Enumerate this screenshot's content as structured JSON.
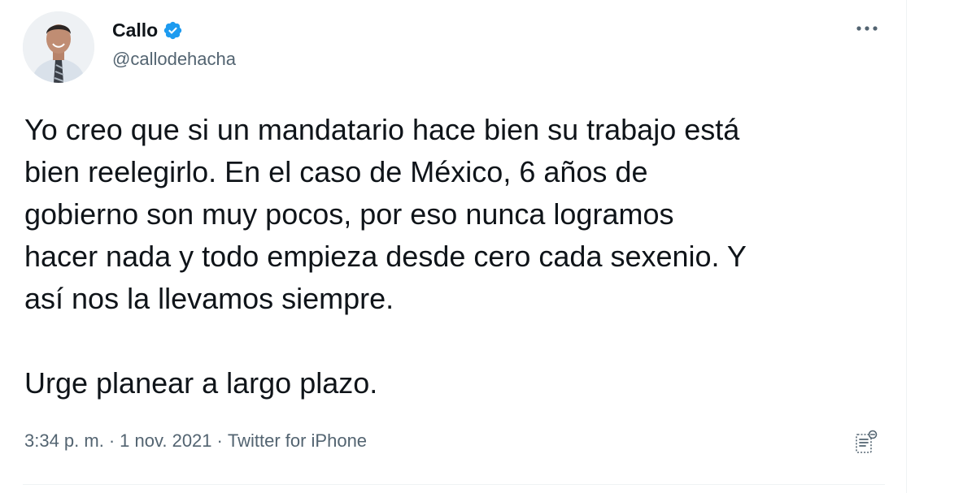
{
  "author": {
    "display_name": "Callo",
    "handle": "@callodehacha",
    "verified": true
  },
  "tweet": {
    "paragraphs": [
      "Yo creo que si un mandatario hace bien su trabajo está bien reelegirlo. En el caso de México, 6 años de gobierno son muy pocos, por eso nunca logramos hacer nada y todo empieza desde cero cada sexenio. Y así nos la llevamos siempre.",
      "Urge planear a largo plazo."
    ],
    "lines_p1": [
      "Yo creo que si un mandatario hace bien su trabajo está",
      "bien reelegirlo. En el caso de México, 6 años de",
      "gobierno son muy pocos, por eso nunca logramos",
      "hacer nada y todo empieza desde cero cada sexenio. Y",
      "así nos la llevamos siempre."
    ],
    "time": "3:34 p. m.",
    "separator": "·",
    "date": "1 nov. 2021",
    "source": "Twitter for iPhone"
  },
  "icons": {
    "verified": "verified-badge-icon",
    "more": "more-options-icon",
    "analytics": "analytics-icon"
  },
  "colors": {
    "text": "#0f1419",
    "secondary": "#536471",
    "verified_blue": "#1d9bf0",
    "divider": "#eff3f4"
  }
}
